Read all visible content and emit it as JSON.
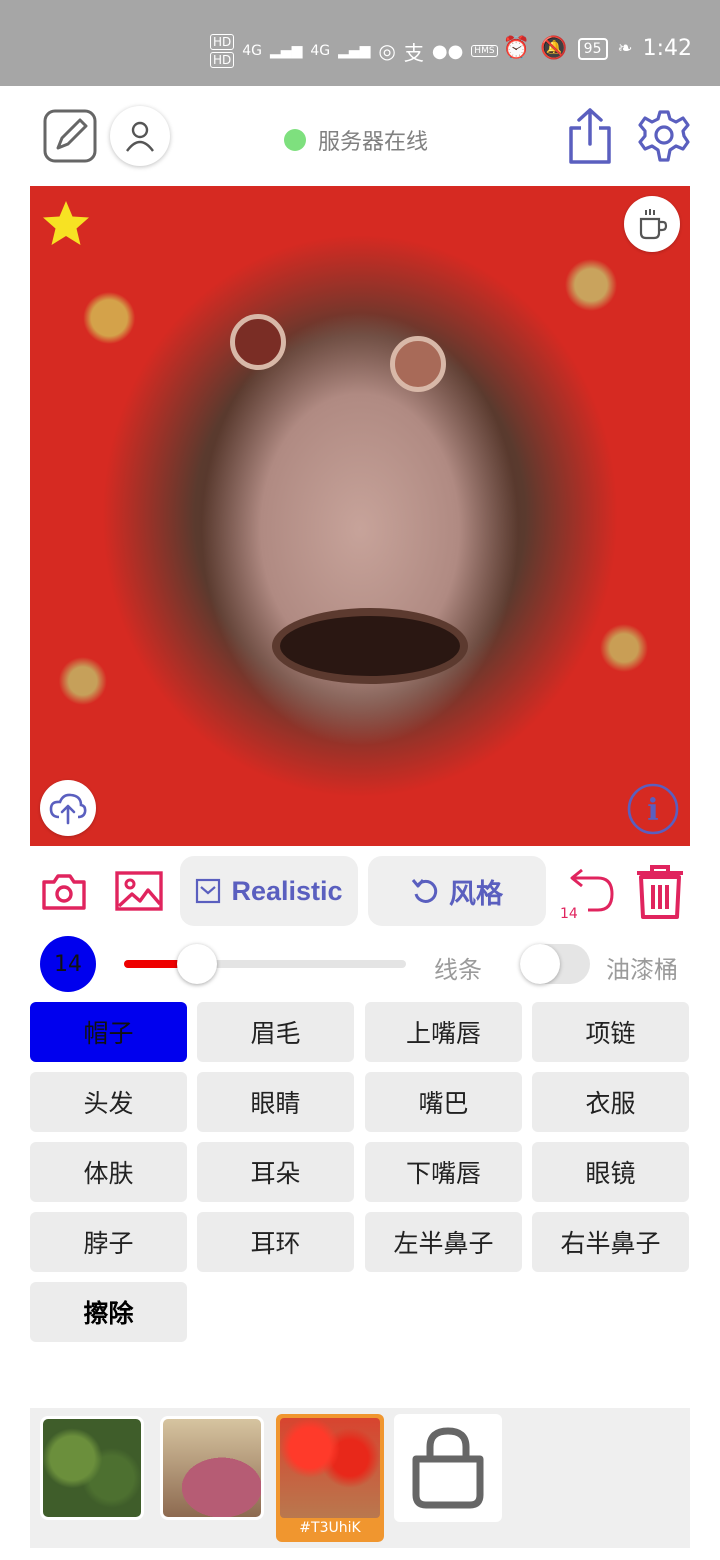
{
  "statusbar": {
    "time": "1:42",
    "battery": "95",
    "hd1": "HD",
    "hd2": "HD",
    "net1": "4G",
    "net2": "4G",
    "alipay": "支",
    "hms": "HMS"
  },
  "header": {
    "server_status": "服务器在线",
    "status_color": "#7ee07e"
  },
  "canvas": {
    "icons": [
      "star-icon",
      "coffee-cup-icon",
      "upload-cloud-icon",
      "info-icon"
    ]
  },
  "toolbar": {
    "realistic_label": "Realistic",
    "style_label": "风格",
    "undo_count": "14",
    "accent": "#5a5fbf",
    "danger": "#e0245e"
  },
  "brush": {
    "size": "14",
    "slider_fraction": 0.26,
    "lines_label": "线条",
    "bucket_label": "油漆桶",
    "bucket_on": false
  },
  "labels": [
    {
      "text": "帽子",
      "active": true
    },
    {
      "text": "眉毛"
    },
    {
      "text": "上嘴唇"
    },
    {
      "text": "项链"
    },
    {
      "text": "头发"
    },
    {
      "text": "眼睛"
    },
    {
      "text": "嘴巴"
    },
    {
      "text": "衣服"
    },
    {
      "text": "体肤"
    },
    {
      "text": "耳朵"
    },
    {
      "text": "下嘴唇"
    },
    {
      "text": "眼镜"
    },
    {
      "text": "脖子"
    },
    {
      "text": "耳环"
    },
    {
      "text": "左半鼻子"
    },
    {
      "text": "右半鼻子"
    },
    {
      "text": "擦除",
      "bold": true
    }
  ],
  "gallery": {
    "selected_label": "#T3UhiK"
  }
}
